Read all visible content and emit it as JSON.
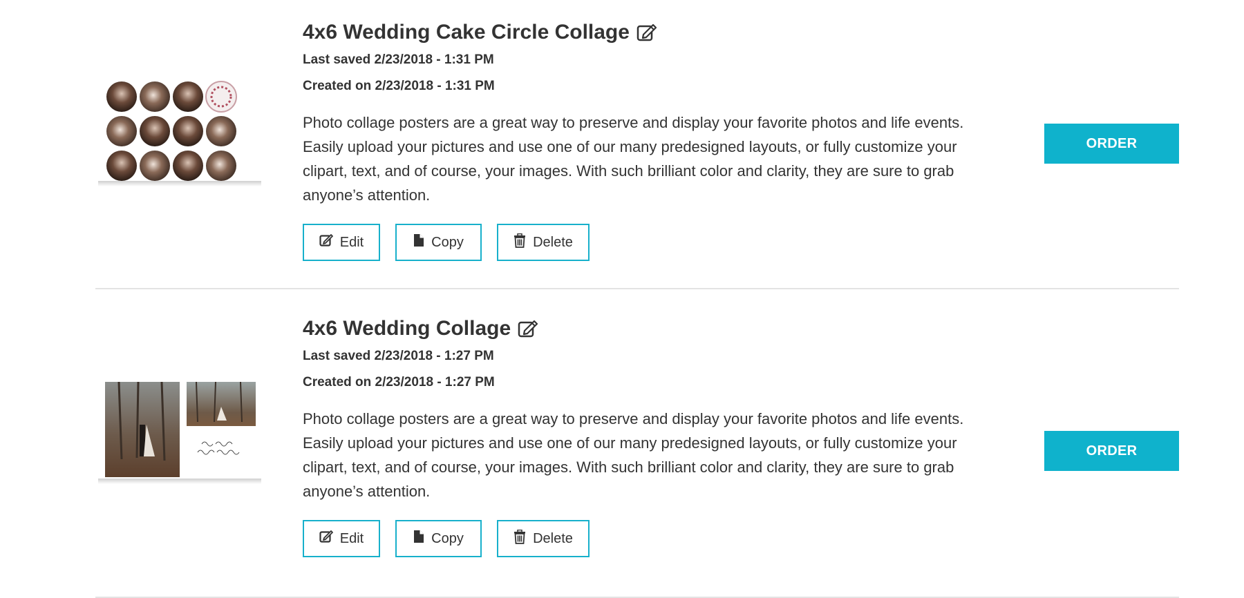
{
  "projects": [
    {
      "title": "4x6 Wedding Cake Circle Collage",
      "last_saved": "Last saved 2/23/2018 - 1:31 PM",
      "created": "Created on 2/23/2018 - 1:31 PM",
      "description": "Photo collage posters are a great way to preserve and display your favorite photos and life events. Easily upload your pictures and use one of our many predesigned layouts, or fully customize your clipart, text, and of course, your images. With such brilliant color and clarity, they are sure to grab anyone’s attention.",
      "edit_label": "Edit",
      "copy_label": "Copy",
      "delete_label": "Delete",
      "order_label": "ORDER",
      "thumbnail_icon": "circle-collage-thumbnail"
    },
    {
      "title": "4x6 Wedding Collage",
      "last_saved": "Last saved 2/23/2018 - 1:27 PM",
      "created": "Created on 2/23/2018 - 1:27 PM",
      "description": "Photo collage posters are a great way to preserve and display your favorite photos and life events. Easily upload your pictures and use one of our many predesigned layouts, or fully customize your clipart, text, and of course, your images. With such brilliant color and clarity, they are sure to grab anyone’s attention.",
      "edit_label": "Edit",
      "copy_label": "Copy",
      "delete_label": "Delete",
      "order_label": "ORDER",
      "thumbnail_icon": "wedding-collage-thumbnail"
    }
  ],
  "colors": {
    "accent": "#0fb2cc",
    "button_border": "#17b0cb",
    "text": "#333333",
    "divider": "#e3e3e3"
  }
}
